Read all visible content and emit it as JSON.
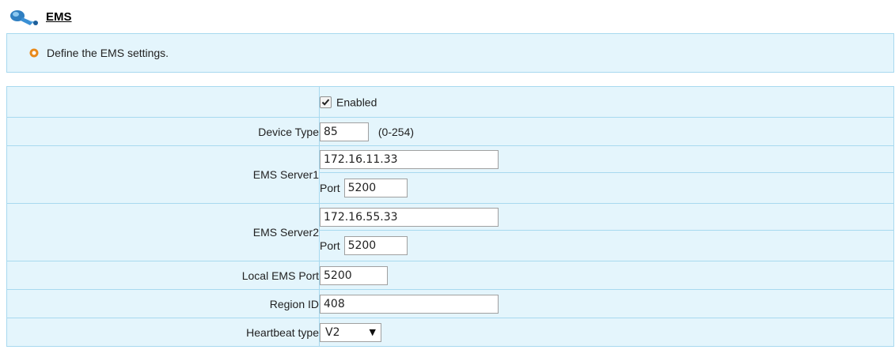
{
  "header": {
    "title": "EMS",
    "icon": "network-satellite-icon"
  },
  "info": {
    "text": "Define the EMS settings.",
    "dot_color": "#e8891a"
  },
  "form": {
    "enabled": {
      "label": "Enabled",
      "checked": true
    },
    "device_type": {
      "label": "Device Type",
      "value": "85",
      "hint": "(0-254)"
    },
    "server1": {
      "label": "EMS Server1",
      "ip": "172.16.11.33",
      "port_label": "Port",
      "port": "5200"
    },
    "server2": {
      "label": "EMS Server2",
      "ip": "172.16.55.33",
      "port_label": "Port",
      "port": "5200"
    },
    "local_port": {
      "label": "Local EMS Port",
      "value": "5200"
    },
    "region_id": {
      "label": "Region ID",
      "value": "408"
    },
    "heartbeat": {
      "label": "Heartbeat type",
      "value": "V2"
    }
  },
  "colors": {
    "panel_bg": "#e4f5fc",
    "panel_border": "#a8d9ef"
  }
}
